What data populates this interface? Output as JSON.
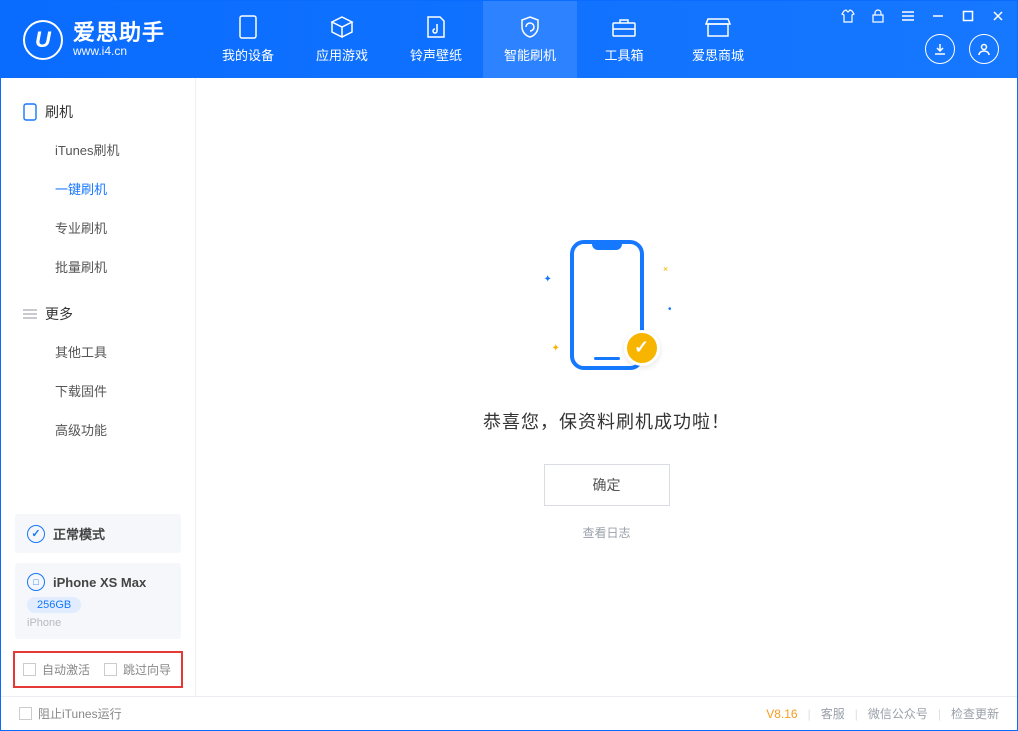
{
  "app": {
    "name": "爱思助手",
    "url": "www.i4.cn"
  },
  "nav": {
    "items": [
      {
        "label": "我的设备"
      },
      {
        "label": "应用游戏"
      },
      {
        "label": "铃声壁纸"
      },
      {
        "label": "智能刷机"
      },
      {
        "label": "工具箱"
      },
      {
        "label": "爱思商城"
      }
    ]
  },
  "sidebar": {
    "group1": {
      "title": "刷机",
      "items": [
        "iTunes刷机",
        "一键刷机",
        "专业刷机",
        "批量刷机"
      ]
    },
    "group2": {
      "title": "更多",
      "items": [
        "其他工具",
        "下载固件",
        "高级功能"
      ]
    }
  },
  "mode_card": {
    "label": "正常模式"
  },
  "device_card": {
    "name": "iPhone XS Max",
    "storage": "256GB",
    "type": "iPhone"
  },
  "options": {
    "auto_activate": "自动激活",
    "skip_guide": "跳过向导"
  },
  "main": {
    "success_msg": "恭喜您，保资料刷机成功啦！",
    "ok_label": "确定",
    "log_link": "查看日志"
  },
  "statusbar": {
    "block_itunes": "阻止iTunes运行",
    "version": "V8.16",
    "links": [
      "客服",
      "微信公众号",
      "检查更新"
    ]
  }
}
